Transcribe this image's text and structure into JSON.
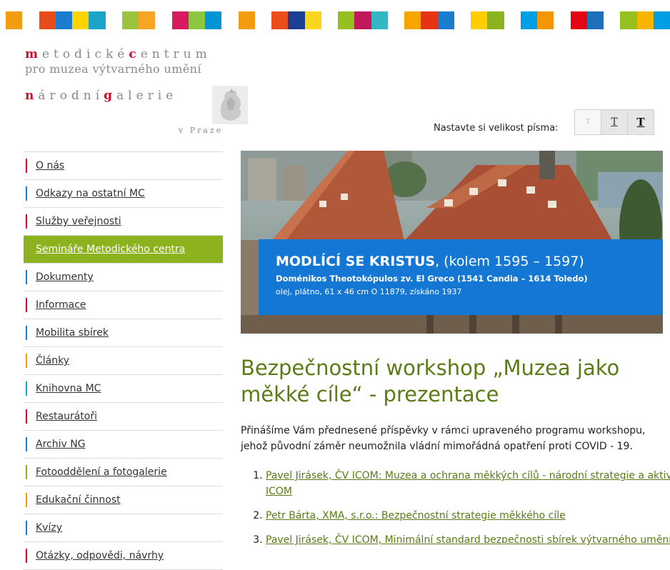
{
  "stripe_colors": [
    "#f39c12",
    "#ffffff",
    "#e84c1b",
    "#1a7ccf",
    "#ffd400",
    "#1aa5c8",
    "#ffffff",
    "#9cc33c",
    "#f6a623",
    "#ffffff",
    "#d81b60",
    "#8dc63f",
    "#0096d6",
    "#ffffff",
    "#f39c12",
    "#ffffff",
    "#e94e1b",
    "#1c3f94",
    "#f9d71c",
    "#ffffff",
    "#93c01f",
    "#c2185b",
    "#35b6c4",
    "#ffffff",
    "#f7a600",
    "#e63312",
    "#1a7ccf",
    "#ffffff",
    "#ffcd00",
    "#8cb31e",
    "#ffffff",
    "#009fe3",
    "#f49600",
    "#ffffff",
    "#e30613",
    "#1d71b8",
    "#ffffff",
    "#95c11f",
    "#f8b500",
    "#009fe3"
  ],
  "logo": {
    "line1_a": "m",
    "line1_b": "etodické",
    "line1_c": "c",
    "line1_d": "entrum",
    "line2": "pro muzea výtvarného umění",
    "line3_a": "n",
    "line3_b": "árodní",
    "line3_c": "g",
    "line3_d": "alerie",
    "line4": "v Praze"
  },
  "nav": {
    "items": [
      {
        "label": "O nás",
        "color": "#c8102e"
      },
      {
        "label": "Odkazy na ostatní MC",
        "color": "#1a7ccf"
      },
      {
        "label": "Služby veřejnosti",
        "color": "#c8102e"
      },
      {
        "label": "Semináře Metodického centra",
        "color": "#8cb31e",
        "active": true
      },
      {
        "label": "Dokumenty",
        "color": "#1a7ccf"
      },
      {
        "label": "Informace",
        "color": "#c8102e"
      },
      {
        "label": "Mobilita sbírek",
        "color": "#1a7ccf"
      },
      {
        "label": "Články",
        "color": "#f39c12"
      },
      {
        "label": "Knihovna MC",
        "color": "#1aa5c8"
      },
      {
        "label": "Restaurátoři",
        "color": "#c8102e"
      },
      {
        "label": "Archiv NG",
        "color": "#1a7ccf"
      },
      {
        "label": "Fotooddělení a fotogalerie",
        "color": "#8cb31e"
      },
      {
        "label": "Edukační činnost",
        "color": "#f39c12"
      },
      {
        "label": "Kvízy",
        "color": "#1a7ccf"
      },
      {
        "label": "Otázky, odpovědi, návrhy",
        "color": "#c8102e"
      }
    ]
  },
  "font_control": {
    "label": "Nastavte si velikost písma:",
    "small": "T",
    "medium": "T",
    "large": "T"
  },
  "banner": {
    "title_bold": "MODLÍCÍ SE KRISTUS",
    "title_rest": ", (kolem 1595 – 1597)",
    "artist": "Doménikos Theotokópulos zv. El Greco (1541 Candia – 1614 Toledo)",
    "details": "olej, plátno, 61 x 46 cm O 11879, získáno 1937"
  },
  "main": {
    "heading": "Bezpečnostní workshop „Muzea jako měkké cíle“ - prezentace",
    "intro": "Přinášíme Vám přednesené příspěvky v rámci upraveného programu workshopu, jehož původní záměr neumožnila vládní mimořádná opatření proti COVID - 19.",
    "links": [
      "Pavel Jirásek, ČV ICOM: Muzea a ochrana měkkých cílů - národní strategie a aktivity ICOM",
      "Petr Bárta, XMA, s.r.o.:  Bezpečnostní strategie měkkého cíle",
      "Pavel Jirásek, ČV ICOM, Minimální standard bezpečnosti sbírek výtvarného umění"
    ]
  }
}
